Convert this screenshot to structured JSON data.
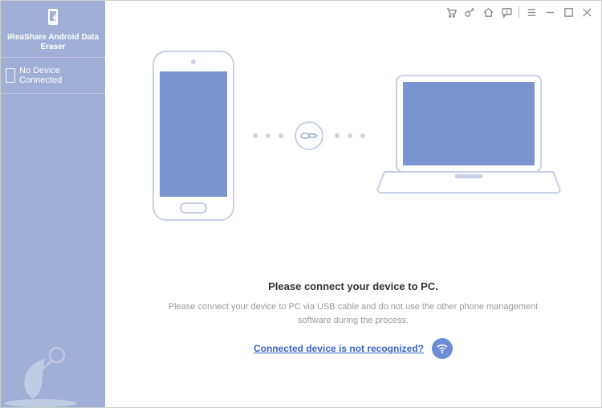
{
  "app": {
    "brand": "iReaShare Android Data Eraser"
  },
  "sidebar": {
    "device_status": "No Device Connected"
  },
  "titlebar": {
    "icons": {
      "cart": "cart-icon",
      "key": "key-icon",
      "home": "home-icon",
      "help": "help-icon",
      "menu": "menu-icon",
      "minimize": "minimize",
      "maximize": "maximize",
      "close": "close"
    }
  },
  "main": {
    "headline": "Please connect your device to PC.",
    "subtext": "Please connect your device to PC via USB cable and do not use the other phone management software during the process.",
    "help_link": "Connected device is not recognized?"
  },
  "colors": {
    "sidebar": "#9fafd6",
    "accent": "#6c8cd5",
    "device_fill": "#7a94cf",
    "outline": "#c8d0e6",
    "link": "#3a62c6"
  }
}
